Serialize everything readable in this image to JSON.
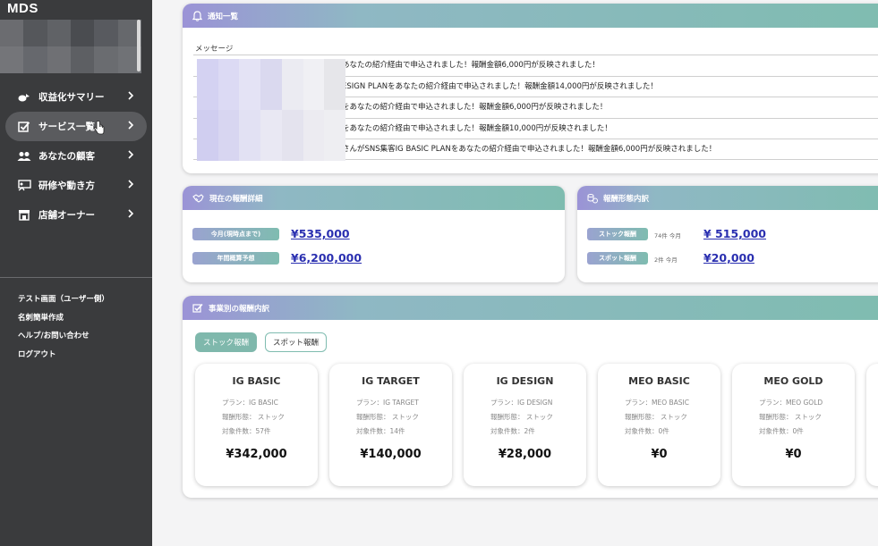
{
  "app": {
    "logo": "MDS"
  },
  "sidebar": {
    "items": [
      {
        "label": "収益化サマリー",
        "icon": "chart-icon"
      },
      {
        "label": "サービス一覧",
        "icon": "checkbox-icon",
        "active": true
      },
      {
        "label": "あなたの顧客",
        "icon": "people-icon"
      },
      {
        "label": "研修や動き方",
        "icon": "training-icon"
      },
      {
        "label": "店舗オーナー",
        "icon": "store-icon"
      }
    ],
    "links": [
      "テスト画面（ユーザー側）",
      "名刺簡単作成",
      "ヘルプ/お問い合わせ",
      "ログアウト"
    ]
  },
  "notifications": {
    "title": "通知一覧",
    "column": "メッセージ",
    "rows": [
      "あなたの紹介経由で申込されました！報酬金額6,000円が反映されました！",
      "ESIGN PLANをあなたの紹介経由で申込されました！報酬金額14,000円が反映されました！",
      "をあなたの紹介経由で申込されました！報酬金額6,000円が反映されました！",
      "をあなたの紹介経由で申込されました！報酬金額10,000円が反映されました！",
      "さんがSNS集客IG BASIC PLANをあなたの紹介経由で申込されました！報酬金額6,000円が反映されました！"
    ]
  },
  "current": {
    "title": "現在の報酬詳細",
    "month_label": "今月(現時点まで)",
    "month_value": "¥535,000",
    "year_label": "年間概算予想",
    "year_value": "¥6,200,000"
  },
  "breakdown": {
    "title": "報酬形態内訳",
    "stock_label": "ストック報酬",
    "stock_note": "74件 今月",
    "stock_value": "¥ 515,000",
    "spot_label": "スポット報酬",
    "spot_note": "2件 今月",
    "spot_value": "¥20,000"
  },
  "business": {
    "title": "事業別の報酬内訳",
    "tab_stock": "ストック報酬",
    "tab_spot": "スポット報酬",
    "plans": [
      {
        "name": "IG BASIC",
        "plan": "プラン：IG BASIC",
        "type": "報酬形態： ストック",
        "count": "対象件数：57件",
        "amount": "¥342,000"
      },
      {
        "name": "IG TARGET",
        "plan": "プラン：IG TARGET",
        "type": "報酬形態： ストック",
        "count": "対象件数：14件",
        "amount": "¥140,000"
      },
      {
        "name": "IG DESIGN",
        "plan": "プラン：IG DESIGN",
        "type": "報酬形態： ストック",
        "count": "対象件数：2件",
        "amount": "¥28,000"
      },
      {
        "name": "MEO BASIC",
        "plan": "プラン：MEO BASIC",
        "type": "報酬形態： ストック",
        "count": "対象件数：0件",
        "amount": "¥0"
      },
      {
        "name": "MEO GOLD",
        "plan": "プラン：MEO GOLD",
        "type": "報酬形態： ストック",
        "count": "対象件数：0件",
        "amount": "¥0"
      }
    ]
  },
  "colors": {
    "sidebar": "#3a3b3d",
    "accent": "#7fbcb0",
    "accent2": "#9b93d6",
    "amount": "#2a2fb0"
  }
}
